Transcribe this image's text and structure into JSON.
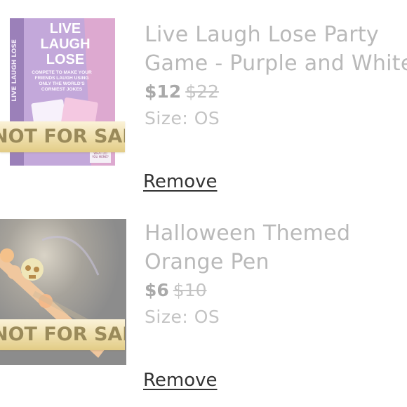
{
  "items": [
    {
      "title_line1": "Live Laugh Lose Party",
      "title_line2": "Game - Purple and White",
      "price": "$12",
      "original_price": "$22",
      "size": "Size: OS",
      "remove_label": "Remove",
      "banner": "NOT FOR SALE",
      "box_art": {
        "title_lines": [
          "LIVE",
          "LAUGH",
          "LOSE"
        ],
        "tagline": "COMPETE TO MAKE YOUR FRIENDS LAUGH USING ONLY THE WORLD'S CORNIEST JOKES",
        "spine": "LIVE LAUGH LOSE",
        "badge": "WHAT DO YOU MEME?"
      }
    },
    {
      "title_line1": "Halloween Themed",
      "title_line2": "Orange Pen",
      "price": "$6",
      "original_price": "$10",
      "size": "Size: OS",
      "remove_label": "Remove",
      "banner": "NOT FOR SALE"
    }
  ],
  "colors": {
    "box_purple": "#a987c4",
    "box_pink": "#d58bb8",
    "banner_gold": "#efe0b0",
    "pen_orange": "#f2c49a",
    "photo_dark": "#8f8f8f"
  }
}
